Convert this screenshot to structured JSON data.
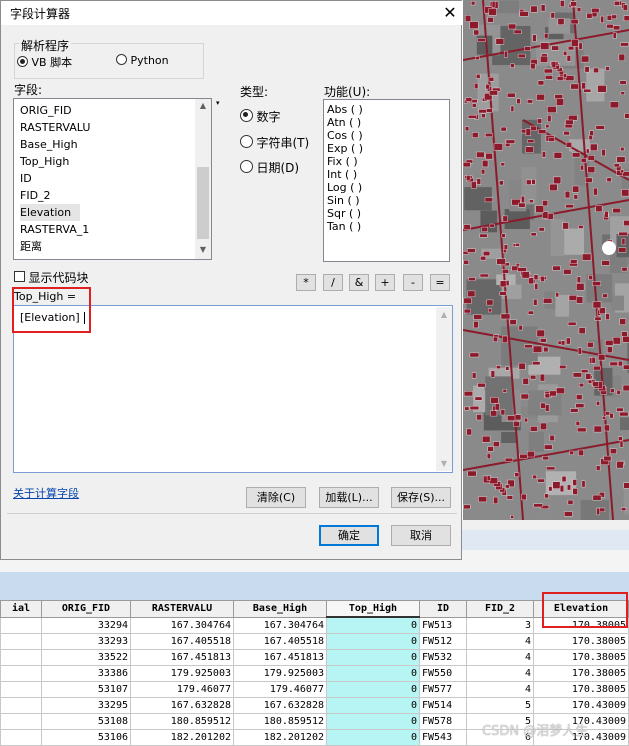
{
  "dialog": {
    "title": "字段计算器",
    "parser_group_label": "解析程序",
    "parser_options": [
      "VB 脚本",
      "Python"
    ],
    "fields_label": "字段:",
    "fields": [
      "ORIG_FID",
      "RASTERVALU",
      "Base_High",
      "Top_High",
      "ID",
      "FID_2",
      "Elevation",
      "RASTERVA_1",
      "距离"
    ],
    "selected_field": "Elevation",
    "type_label": "类型:",
    "type_options": [
      "数字",
      "字符串(T)",
      "日期(D)"
    ],
    "functions_label": "功能(U):",
    "functions": [
      "Abs ( )",
      "Atn ( )",
      "Cos ( )",
      "Exp ( )",
      "Fix ( )",
      "Int ( )",
      "Log ( )",
      "Sin ( )",
      "Sqr ( )",
      "Tan ( )"
    ],
    "show_codeblock_label": "显示代码块",
    "operators": [
      "*",
      "/",
      "&",
      "+",
      "-",
      "="
    ],
    "expression_label": "Top_High =",
    "expression_value": "[Elevation]",
    "help_link": "关于计算字段",
    "clear_button": "清除(C)",
    "load_button": "加载(L)...",
    "save_button": "保存(S)...",
    "ok_button": "确定",
    "cancel_button": "取消"
  },
  "table": {
    "headers": [
      "ial",
      "ORIG_FID",
      "RASTERVALU",
      "Base_High",
      "Top_High",
      "ID",
      "FID_2",
      "Elevation"
    ],
    "rows": [
      [
        "",
        "33294",
        "167.304764",
        "167.304764",
        "0",
        "FW513",
        "3",
        "170.38005"
      ],
      [
        "",
        "33293",
        "167.405518",
        "167.405518",
        "0",
        "FW512",
        "4",
        "170.38005"
      ],
      [
        "",
        "33522",
        "167.451813",
        "167.451813",
        "0",
        "FW532",
        "4",
        "170.38005"
      ],
      [
        "",
        "33386",
        "179.925003",
        "179.925003",
        "0",
        "FW550",
        "4",
        "170.38005"
      ],
      [
        "",
        "53107",
        "179.46077",
        "179.46077",
        "0",
        "FW577",
        "4",
        "170.38005"
      ],
      [
        "",
        "33295",
        "167.632828",
        "167.632828",
        "0",
        "FW514",
        "5",
        "170.43009"
      ],
      [
        "",
        "53108",
        "180.859512",
        "180.859512",
        "0",
        "FW578",
        "5",
        "170.43009"
      ],
      [
        "",
        "53106",
        "182.201202",
        "182.201202",
        "0",
        "FW543",
        "6",
        "170.43009"
      ]
    ]
  },
  "watermark": "CSDN @泪梦人生",
  "colors": {
    "accent": "#0078d7",
    "highlight": "#e02020",
    "building": "#8b1a2b",
    "cyan_cell": "#b7f5f5"
  }
}
